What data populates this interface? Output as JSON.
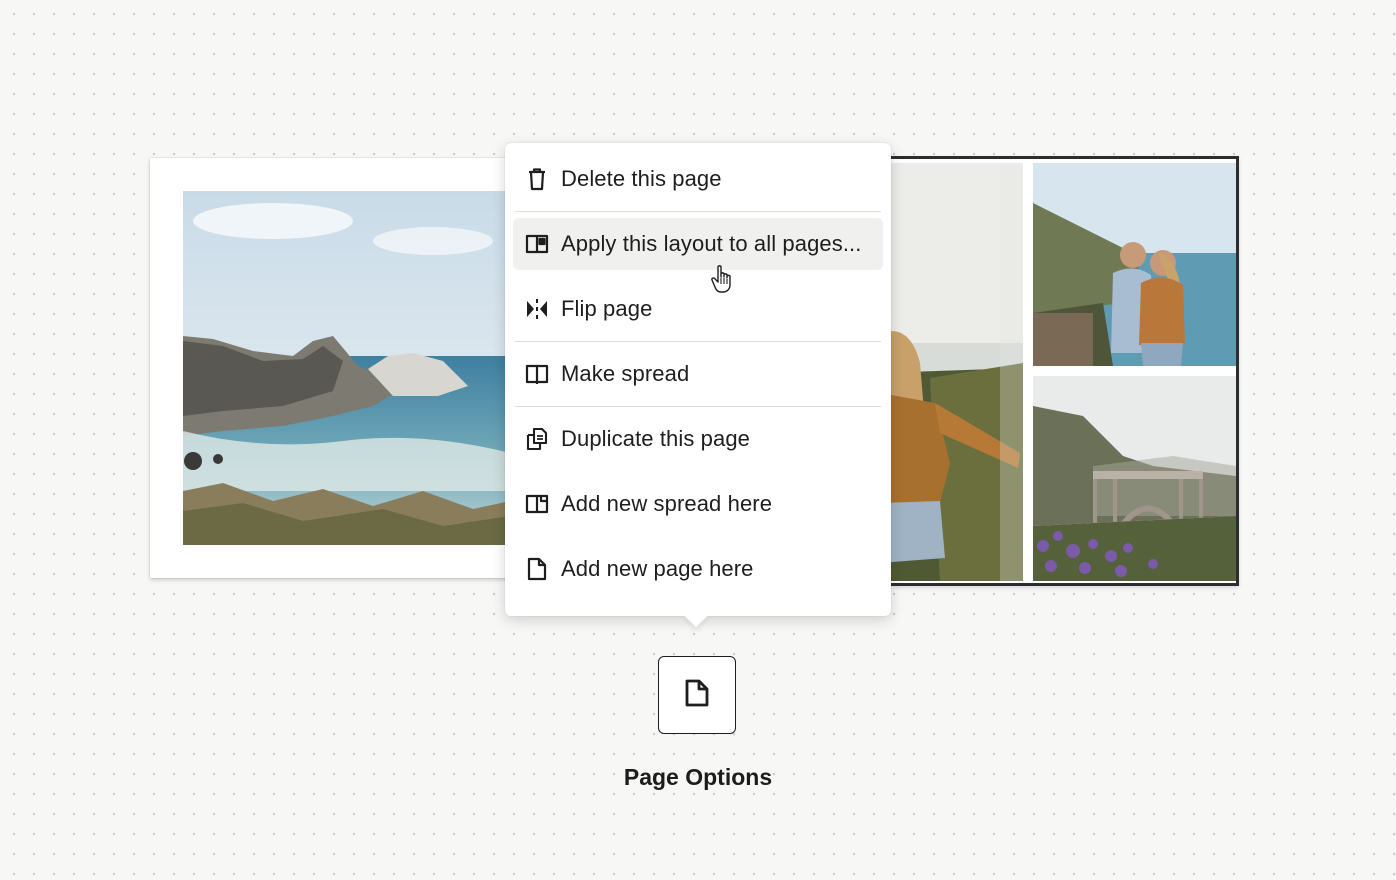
{
  "menu": {
    "items": [
      {
        "label": "Delete this page",
        "icon": "trash-icon"
      },
      {
        "label": "Apply this layout to all pages...",
        "icon": "layout-icon",
        "active": true
      },
      {
        "label": "Flip page",
        "icon": "flip-icon"
      },
      {
        "label": "Make spread",
        "icon": "book-open-icon"
      },
      {
        "label": "Duplicate this page",
        "icon": "duplicate-icon"
      },
      {
        "label": "Add new spread here",
        "icon": "add-spread-icon"
      },
      {
        "label": "Add new page here",
        "icon": "add-page-icon"
      }
    ]
  },
  "page_options": {
    "label": "Page Options",
    "icon": "page-icon"
  },
  "colors": {
    "background": "#f7f7f6",
    "menu_active": "#f0f0ef",
    "text": "#1e1e1e",
    "selected_border": "#2b2d31"
  }
}
